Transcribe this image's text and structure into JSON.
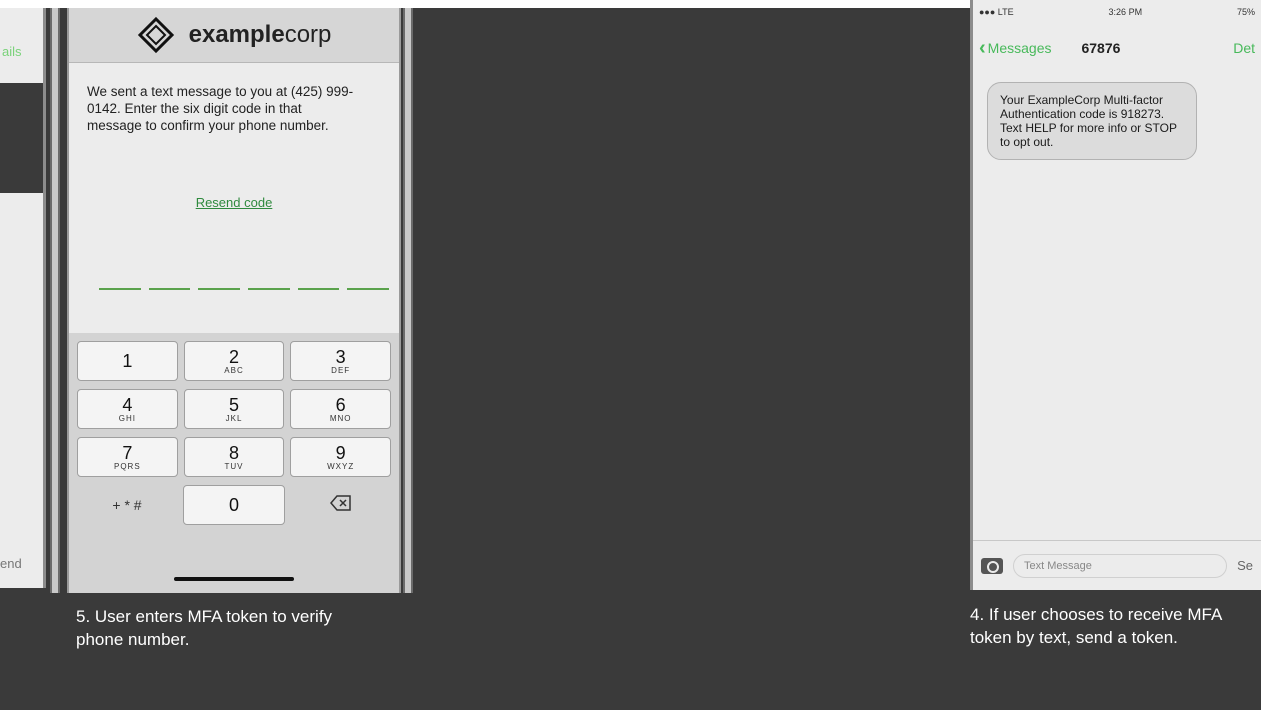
{
  "left_phone": {
    "nav_fragment": "ails",
    "bottom_fragment": "end"
  },
  "center_phone": {
    "brand": {
      "name_bold": "example",
      "name_regular": "corp"
    },
    "message": "We sent a text message to you at (425) 999-0142. Enter the six digit code in that message to confirm your phone number.",
    "resend_label": "Resend code",
    "code_slots": 6,
    "keypad": [
      [
        {
          "digit": "1",
          "letters": ""
        },
        {
          "digit": "2",
          "letters": "ABC"
        },
        {
          "digit": "3",
          "letters": "DEF"
        }
      ],
      [
        {
          "digit": "4",
          "letters": "GHI"
        },
        {
          "digit": "5",
          "letters": "JKL"
        },
        {
          "digit": "6",
          "letters": "MNO"
        }
      ],
      [
        {
          "digit": "7",
          "letters": "PQRS"
        },
        {
          "digit": "8",
          "letters": "TUV"
        },
        {
          "digit": "9",
          "letters": "WXYZ"
        }
      ]
    ],
    "keypad_last_row": {
      "symbols": "+ * #",
      "zero": "0",
      "delete_icon": "backspace-icon"
    }
  },
  "right_phone": {
    "status": {
      "carrier": "●●● LTE",
      "time": "3:26 PM",
      "battery": "75%"
    },
    "nav": {
      "back_label": "Messages",
      "title": "67876",
      "details": "Det"
    },
    "sms_text": "Your ExampleCorp Multi-factor Authentication code is 918273. Text HELP for more info or STOP to opt out.",
    "composer_placeholder": "Text Message",
    "send_label": "Se"
  },
  "captions": {
    "left": "5. User enters MFA token to verify phone number.",
    "right": "4. If user chooses to receive MFA token by text, send a token."
  },
  "colors": {
    "background": "#3a3a3a",
    "accent_green": "#47b95a",
    "brand_bar": "#d6d6d6"
  }
}
